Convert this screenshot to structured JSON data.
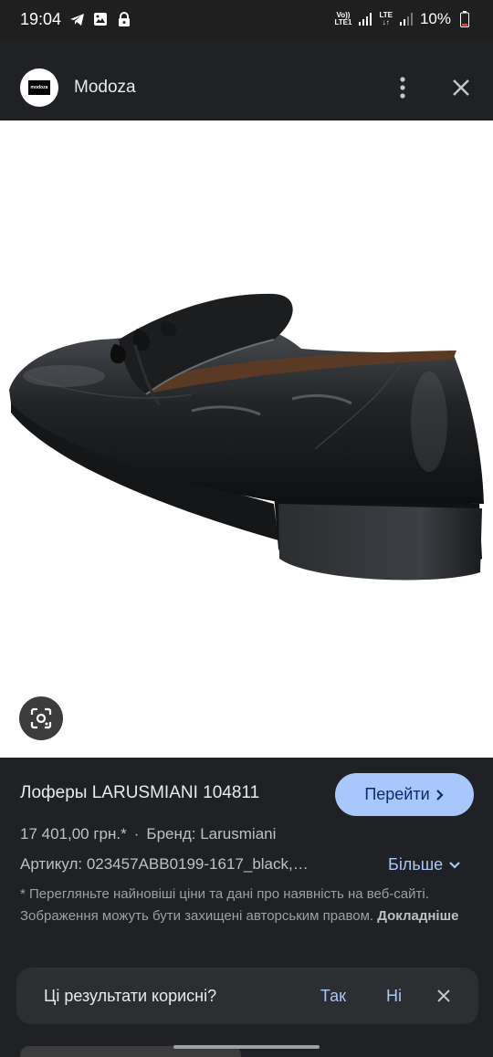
{
  "status": {
    "time": "19:04",
    "net1_top": "Vo))",
    "net1_bottom": "LTE1",
    "net2_top": "LTE",
    "net2_bottom": "↓↑",
    "battery": "10%"
  },
  "header": {
    "logo_text": "modoza",
    "site_name": "Modoza"
  },
  "product": {
    "title": "Лоферы LARUSMIANI 104811",
    "go_label": "Перейти",
    "price": "17 401,00 грн.*",
    "brand": "Бренд: Larusmiani",
    "article": "Артикул: 023457ABB0199-1617_black,…",
    "more_label": "Більше",
    "notice_text": "* Перегляньте найновіші ціни та дані про наявність на веб-сайті. Зображення можуть бути захищені авторським правом.",
    "notice_link": "Докладніше"
  },
  "feedback": {
    "question": "Ці результати корисні?",
    "yes": "Так",
    "no": "Ні"
  },
  "colors": {
    "background": "#202124",
    "accent": "#a8c7fa",
    "button_text": "#062e6f"
  },
  "icons": [
    "telegram-icon",
    "image-icon",
    "lock-icon",
    "signal-icon",
    "battery-icon",
    "more-vert-icon",
    "close-icon",
    "lens-icon",
    "chevron-right-icon",
    "chevron-down-icon"
  ]
}
